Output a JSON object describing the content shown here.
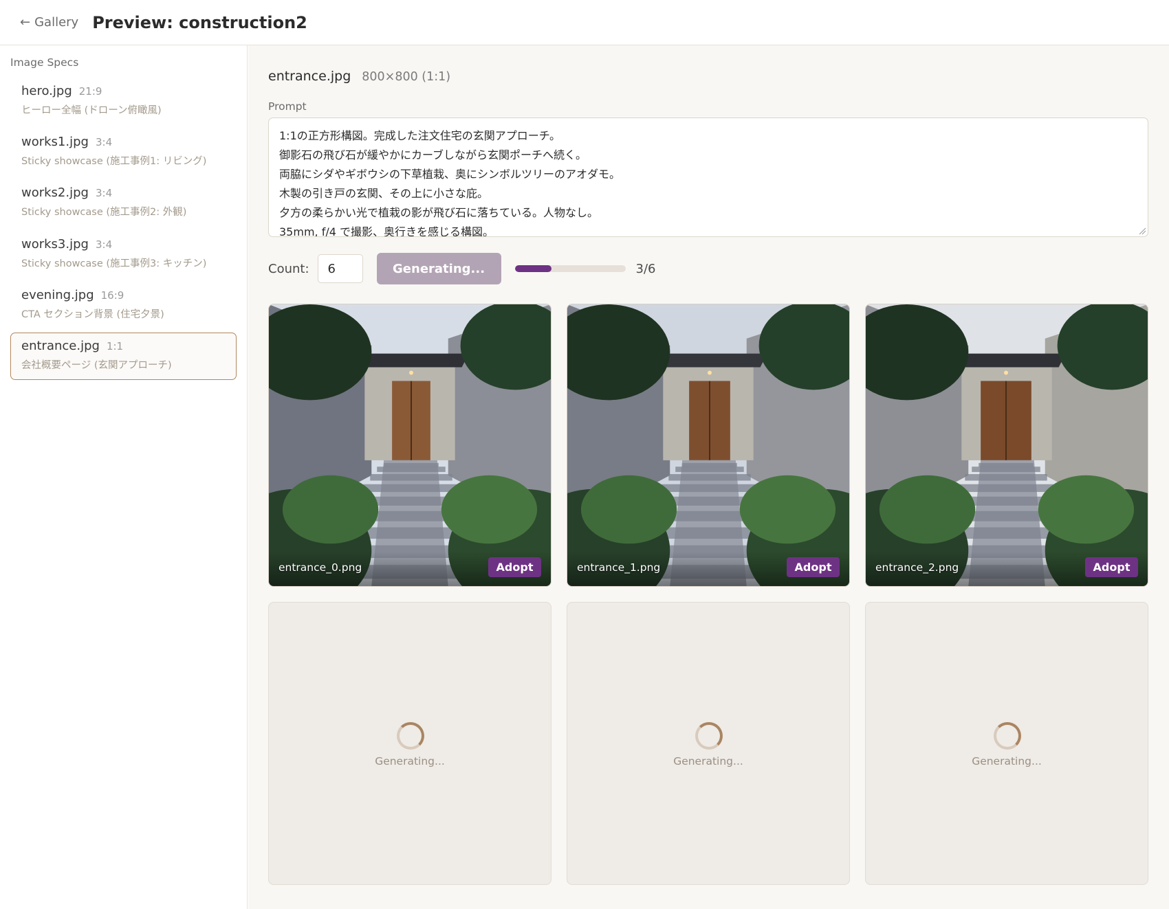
{
  "header": {
    "back_label": "Gallery",
    "title": "Preview: construction2"
  },
  "sidebar": {
    "heading": "Image Specs",
    "items": [
      {
        "name": "hero.jpg",
        "ratio": "21:9",
        "desc": "ヒーロー全幅 (ドローン俯瞰風)"
      },
      {
        "name": "works1.jpg",
        "ratio": "3:4",
        "desc": "Sticky showcase (施工事例1: リビング)"
      },
      {
        "name": "works2.jpg",
        "ratio": "3:4",
        "desc": "Sticky showcase (施工事例2: 外観)"
      },
      {
        "name": "works3.jpg",
        "ratio": "3:4",
        "desc": "Sticky showcase (施工事例3: キッチン)"
      },
      {
        "name": "evening.jpg",
        "ratio": "16:9",
        "desc": "CTA セクション背景 (住宅夕景)"
      },
      {
        "name": "entrance.jpg",
        "ratio": "1:1",
        "desc": "会社概要ページ (玄関アプローチ)",
        "active": true
      }
    ]
  },
  "main": {
    "file_name": "entrance.jpg",
    "file_dims": "800×800 (1:1)",
    "prompt_label": "Prompt",
    "prompt_lines": [
      "1:1の正方形構図。完成した注文住宅の玄関アプローチ。",
      "御影石の飛び石が緩やかにカーブしながら玄関ポーチへ続く。",
      "両脇にシダやギボウシの下草植栽、奥にシンボルツリーのアオダモ。",
      "木製の引き戸の玄関、その上に小さな庇。",
      "夕方の柔らかい光で植栽の影が飛び石に落ちている。人物なし。",
      "35mm, f/4 で撮影、奥行きを感じる構図。"
    ],
    "count_label": "Count:",
    "count_value": "6",
    "generate_label": "Generating...",
    "progress_fraction": 0.33,
    "progress_text": "3/6",
    "results": [
      {
        "filename": "entrance_0.png",
        "adopt_label": "Adopt"
      },
      {
        "filename": "entrance_1.png",
        "adopt_label": "Adopt"
      },
      {
        "filename": "entrance_2.png",
        "adopt_label": "Adopt"
      }
    ],
    "pending": [
      {
        "label": "Generating..."
      },
      {
        "label": "Generating..."
      },
      {
        "label": "Generating..."
      }
    ]
  },
  "colors": {
    "accent": "#6e3284",
    "generate_disabled": "#b3a4b5",
    "active_border": "#b2865e"
  }
}
